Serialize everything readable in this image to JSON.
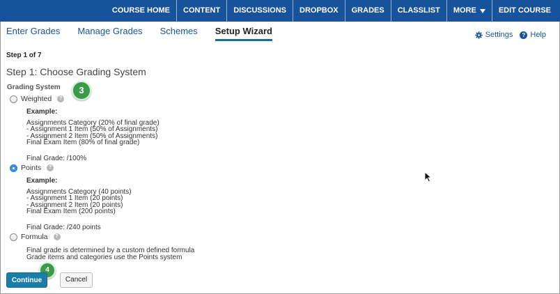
{
  "topnav": {
    "items": [
      "COURSE HOME",
      "CONTENT",
      "DISCUSSIONS",
      "DROPBOX",
      "GRADES",
      "CLASSLIST",
      "MORE",
      "EDIT COURSE"
    ]
  },
  "tabs": {
    "items": [
      "Enter Grades",
      "Manage Grades",
      "Schemes",
      "Setup Wizard"
    ],
    "active": "Setup Wizard"
  },
  "tools": {
    "settings": "Settings",
    "help": "Help"
  },
  "wizard": {
    "step_count": "Step 1 of 7",
    "title": "Step 1: Choose Grading System",
    "section_label": "Grading System"
  },
  "callouts": {
    "a": "3",
    "b": "4"
  },
  "options": {
    "weighted": {
      "label": "Weighted",
      "selected": false,
      "example_title": "Example:",
      "lines": [
        "Assignments Category (20% of final grade)",
        "- Assignment 1 Item (50% of Assignments)",
        "- Assignment 2 Item (50% of Assignments)",
        "Final Exam Item (80% of final grade)"
      ],
      "final": "Final Grade: /100%"
    },
    "points": {
      "label": "Points",
      "selected": true,
      "example_title": "Example:",
      "lines": [
        "Assignments Category (40 points)",
        "- Assignment 1 Item (20 points)",
        "- Assignment 2 Item (20 points)",
        "Final Exam Item (200 points)"
      ],
      "final": "Final Grade: /240 points"
    },
    "formula": {
      "label": "Formula",
      "selected": false,
      "lines": [
        "Final grade is determined by a custom defined formula",
        "Grade items and categories use the Points system"
      ]
    }
  },
  "buttons": {
    "continue": "Continue",
    "cancel": "Cancel"
  },
  "colors": {
    "nav_bg": "#17529a",
    "link": "#17529a",
    "primary_button": "#1a7ea8",
    "callout": "#3a9a4a"
  }
}
